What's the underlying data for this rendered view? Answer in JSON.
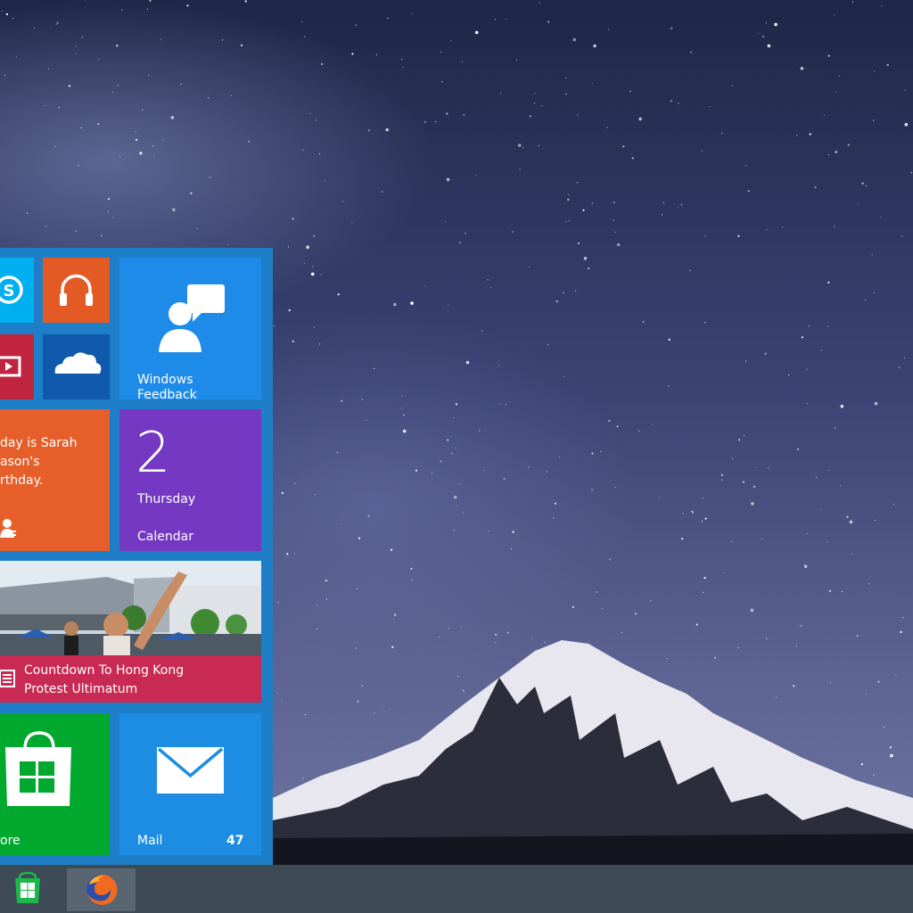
{
  "start_menu": {
    "tiles": {
      "skype": {
        "icon": "skype-icon"
      },
      "music": {
        "icon": "headphones-icon"
      },
      "video": {
        "icon": "video-icon"
      },
      "onedrive": {
        "icon": "cloud-icon"
      },
      "feedback": {
        "label_line1": "Windows",
        "label_line2": "Feedback",
        "icon": "feedback-icon"
      },
      "people": {
        "line1": "day is Sarah",
        "line2": "ason's",
        "line3": "rthday.",
        "icon": "people-icon"
      },
      "calendar": {
        "day_number": "2",
        "weekday": "Thursday",
        "label": "Calendar"
      },
      "news": {
        "headline_line1": "Countdown To Hong Kong",
        "headline_line2": "Protest Ultimatum",
        "icon": "news-icon"
      },
      "store": {
        "label": "ore",
        "icon": "store-bag-icon"
      },
      "mail": {
        "label": "Mail",
        "badge": "47",
        "icon": "envelope-icon"
      }
    }
  },
  "taskbar": {
    "start_icon": "windows-logo-icon",
    "pinned": [
      {
        "app": "firefox",
        "icon": "firefox-icon"
      }
    ]
  },
  "colors": {
    "start_menu_bg": "#1e7fc8",
    "taskbar_bg": "#3f4a57",
    "skype": "#00aff0",
    "music": "#e35a25",
    "video": "#c1243f",
    "onedrive": "#1159ad",
    "feedback": "#1f8be8",
    "people": "#e65f2b",
    "calendar": "#7438c2",
    "news": "#c82a53",
    "store": "#00a82d",
    "mail": "#1c8de3"
  }
}
